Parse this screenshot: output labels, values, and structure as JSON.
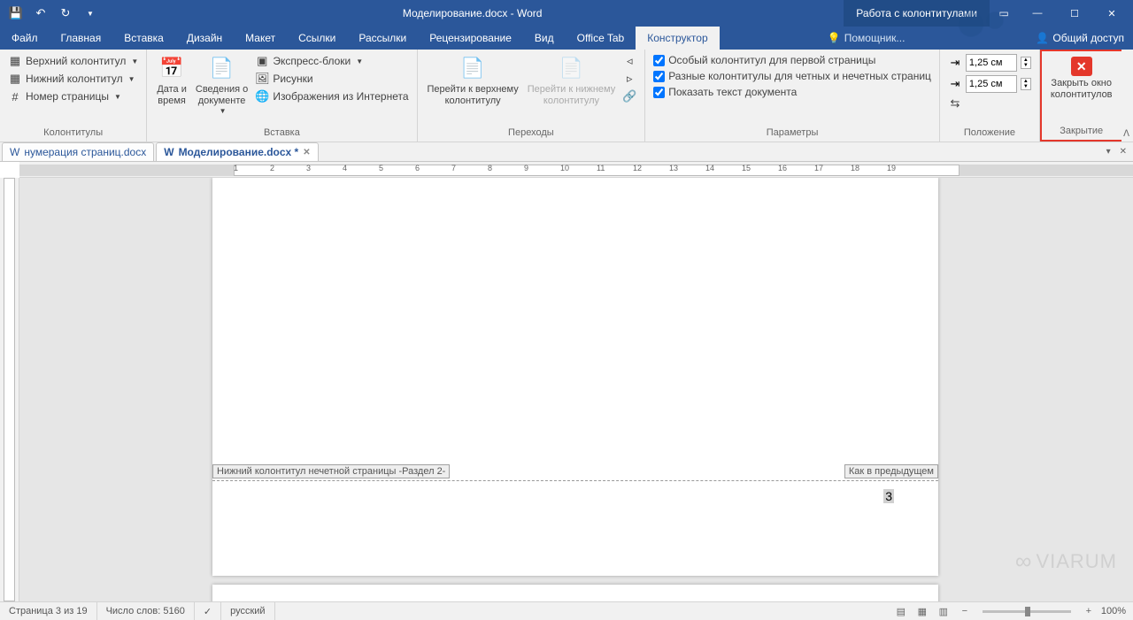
{
  "titlebar": {
    "title": "Моделирование.docx - Word",
    "tools_tab": "Работа с колонтитулами"
  },
  "tabs": {
    "file": "Файл",
    "home": "Главная",
    "insert": "Вставка",
    "design": "Дизайн",
    "layout": "Макет",
    "references": "Ссылки",
    "mailings": "Рассылки",
    "review": "Рецензирование",
    "view": "Вид",
    "office_tab": "Office Tab",
    "designer": "Конструктор",
    "tell_me": "Помощник...",
    "share": "Общий доступ"
  },
  "ribbon": {
    "headerfooter": {
      "header": "Верхний колонтитул",
      "footer": "Нижний колонтитул",
      "pagenum": "Номер страницы",
      "label": "Колонтитулы"
    },
    "insert": {
      "datetime_l1": "Дата и",
      "datetime_l2": "время",
      "docinfo_l1": "Сведения о",
      "docinfo_l2": "документе",
      "quickparts": "Экспресс-блоки",
      "pictures": "Рисунки",
      "onlinepics": "Изображения из Интернета",
      "label": "Вставка"
    },
    "nav": {
      "goto_header_l1": "Перейти к верхнему",
      "goto_header_l2": "колонтитулу",
      "goto_footer_l1": "Перейти к нижнему",
      "goto_footer_l2": "колонтитулу",
      "label": "Переходы"
    },
    "options": {
      "different_first": "Особый колонтитул для первой страницы",
      "different_odd_even": "Разные колонтитулы для четных и нечетных страниц",
      "show_doc_text": "Показать текст документа",
      "label": "Параметры"
    },
    "position": {
      "header_top": "1,25 см",
      "footer_bottom": "1,25 см",
      "label": "Положение"
    },
    "close": {
      "line1": "Закрыть окно",
      "line2": "колонтитулов",
      "label": "Закрытие"
    }
  },
  "doctabs": {
    "tab1": "нумерация страниц.docx",
    "tab2": "Моделирование.docx *"
  },
  "footer_tags": {
    "left": "Нижний колонтитул нечетной страницы -Раздел 2-",
    "right": "Как в предыдущем"
  },
  "page_number": "3",
  "statusbar": {
    "page": "Страница 3 из 19",
    "words": "Число слов: 5160",
    "lang": "русский",
    "zoom": "100%"
  },
  "watermark": "VIARUM"
}
